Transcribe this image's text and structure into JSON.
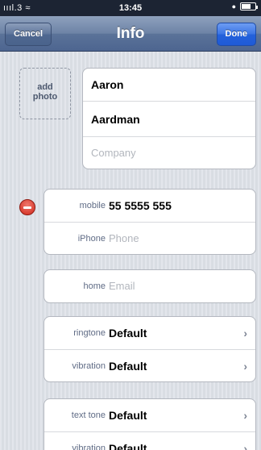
{
  "status": {
    "signal": "3",
    "time": "13:45"
  },
  "nav": {
    "title": "Info",
    "cancel_label": "Cancel",
    "done_label": "Done"
  },
  "photo": {
    "label_line1": "add",
    "label_line2": "photo"
  },
  "name": {
    "first": "Aaron",
    "last": "Aardman",
    "company_placeholder": "Company"
  },
  "phones": [
    {
      "label": "mobile",
      "value": "55 5555 555"
    },
    {
      "label": "iPhone",
      "placeholder": "Phone"
    }
  ],
  "email": {
    "label": "home",
    "placeholder": "Email"
  },
  "ringtone_group": [
    {
      "label": "ringtone",
      "value": "Default"
    },
    {
      "label": "vibration",
      "value": "Default"
    }
  ],
  "texttone_group": [
    {
      "label": "text tone",
      "value": "Default"
    },
    {
      "label": "vibration",
      "value": "Default"
    }
  ],
  "icons": [
    "wifi-icon",
    "lock-icon",
    "battery-icon",
    "delete-minus-icon",
    "chevron-right-icon"
  ],
  "colors": {
    "nav": "#5b7399",
    "done": "#2462db",
    "delete": "#d0261a"
  }
}
